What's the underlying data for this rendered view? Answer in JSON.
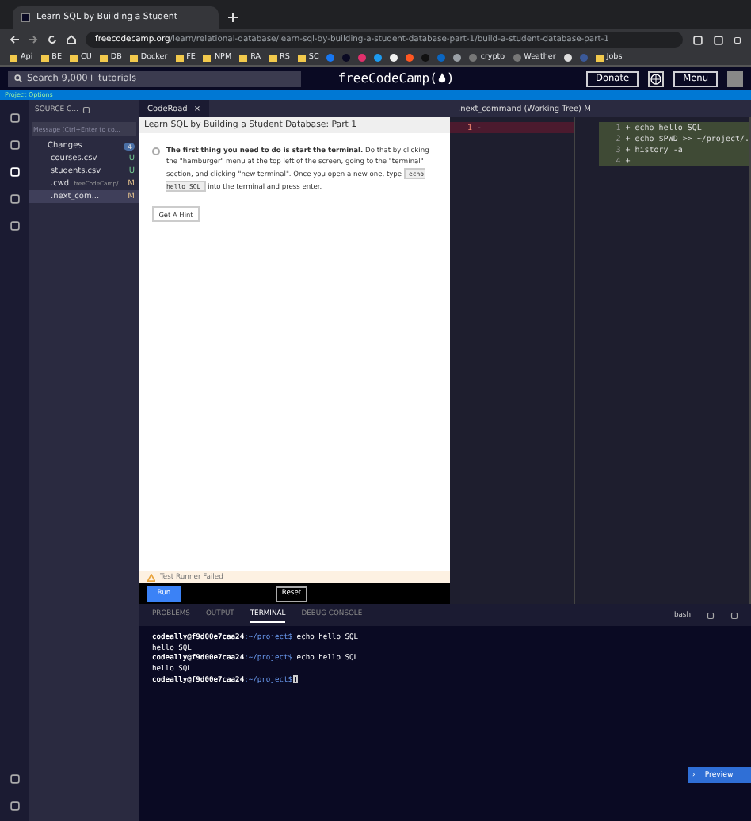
{
  "browser": {
    "tab_title": "Learn SQL by Building a Student",
    "domain": "freecodecamp.org",
    "path": "/learn/relational-database/learn-sql-by-building-a-student-database-part-1/build-a-student-database-part-1"
  },
  "bookmarks": [
    {
      "kind": "folder",
      "label": "Api"
    },
    {
      "kind": "folder",
      "label": "BE"
    },
    {
      "kind": "folder",
      "label": "CU"
    },
    {
      "kind": "folder",
      "label": "DB"
    },
    {
      "kind": "folder",
      "label": "Docker"
    },
    {
      "kind": "folder",
      "label": "FE"
    },
    {
      "kind": "folder",
      "label": "NPM"
    },
    {
      "kind": "folder",
      "label": "RA"
    },
    {
      "kind": "folder",
      "label": "RS"
    },
    {
      "kind": "folder",
      "label": "SC"
    },
    {
      "kind": "icon",
      "color": "#1877f2"
    },
    {
      "kind": "icon",
      "color": "#0a0a23"
    },
    {
      "kind": "icon",
      "color": "#e1306c"
    },
    {
      "kind": "icon",
      "color": "#1d9bf0"
    },
    {
      "kind": "icon",
      "color": "#f0f0f0"
    },
    {
      "kind": "icon",
      "color": "#ff5722"
    },
    {
      "kind": "icon",
      "color": "#111111"
    },
    {
      "kind": "icon",
      "color": "#0a66c2"
    },
    {
      "kind": "icon",
      "color": "#9aa0a6"
    },
    {
      "kind": "site",
      "label": "crypto"
    },
    {
      "kind": "site",
      "label": "Weather"
    },
    {
      "kind": "icon",
      "color": "#dddddd"
    },
    {
      "kind": "icon",
      "color": "#3b5998"
    },
    {
      "kind": "folder",
      "label": "Jobs"
    }
  ],
  "fcc": {
    "search_placeholder": "Search 9,000+ tutorials",
    "logo_left": "freeCodeCamp(",
    "logo_right": ")",
    "donate": "Donate",
    "menu": "Menu"
  },
  "project_options": "Project Options",
  "sidebar": {
    "title": "SOURCE C...",
    "message_placeholder": "Message (Ctrl+Enter to co...",
    "changes": "Changes",
    "count": "4",
    "files": [
      {
        "name": "courses.csv",
        "status": "U",
        "selected": false
      },
      {
        "name": "students.csv",
        "status": "U",
        "selected": false
      },
      {
        "name": ".cwd",
        "detail": ".freeCodeCamp/...",
        "status": "M",
        "selected": false
      },
      {
        "name": ".next_com...",
        "status": "M",
        "selected": true
      }
    ]
  },
  "coderoad": {
    "tab": "CodeRoad",
    "tab_close": "×",
    "title": "Learn SQL by Building a Student Database: Part 1",
    "step_before": "**The first thing you need to do is start the terminal.** Do that by clicking the \"hamburger\" menu at the top left of the screen, going to the \"terminal\" section, and clicking \"new terminal\". Once you open a new one, type",
    "step_code": "echo hello SQL",
    "step_after": "into the terminal and press enter.",
    "hint": "Get A Hint",
    "status": "Test Runner Failed",
    "run": "Run",
    "reset": "Reset"
  },
  "editor": {
    "tab": ".next_command (Working Tree) M",
    "left_lines": [
      {
        "num": "1",
        "sign": "-"
      }
    ],
    "right_lines": [
      {
        "num": "1",
        "sign": "+",
        "text": "echo hello SQL"
      },
      {
        "num": "2",
        "sign": "+",
        "text": "echo $PWD >> ~/project/."
      },
      {
        "num": "3",
        "sign": "+",
        "text": "history -a"
      },
      {
        "num": "4",
        "sign": "+"
      }
    ]
  },
  "panel": {
    "tabs": [
      {
        "label": "PROBLEMS",
        "selected": false
      },
      {
        "label": "OUTPUT",
        "selected": false
      },
      {
        "label": "TERMINAL",
        "selected": true
      },
      {
        "label": "DEBUG CONSOLE",
        "selected": false
      }
    ],
    "shell": "bash",
    "lines": [
      {
        "kind": "prompt",
        "user": "codeally@f9d00e7caa24",
        "path": ":~/project$",
        "cmd": " echo hello SQL"
      },
      {
        "kind": "output",
        "text": "hello SQL"
      },
      {
        "kind": "prompt",
        "user": "codeally@f9d00e7caa24",
        "path": ":~/project$",
        "cmd": " echo hello SQL"
      },
      {
        "kind": "output",
        "text": "hello SQL"
      },
      {
        "kind": "prompt",
        "user": "codeally@f9d00e7caa24",
        "path": ":~/project$"
      }
    ]
  },
  "preview_arrow": "›",
  "preview": "Preview"
}
